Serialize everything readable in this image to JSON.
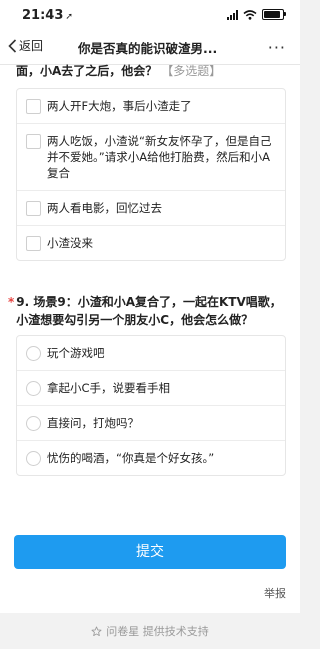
{
  "status_bar": {
    "time": "21:43",
    "location_glyph": "➚",
    "battery_level": 0.9
  },
  "nav": {
    "back_label": "返回",
    "title": "你是否真的能识破渣男...",
    "more_label": "···"
  },
  "question_prev": {
    "title": "面，小A去了之后，他会？",
    "hint": "【多选题】",
    "options": [
      "两人开F大炮，事后小渣走了",
      "两人吃饭，小渣说“新女友怀孕了，但是自己并不爱她。”请求小A给他打胎费，然后和小A复合",
      "两人看电影，回忆过去",
      "小渣没来"
    ]
  },
  "question_9": {
    "required_mark": "*",
    "title": "9. 场景9：小渣和小A复合了，一起在KTV唱歌，小渣想要勾引另一个朋友小C，他会怎么做？",
    "options": [
      "玩个游戏吧",
      "拿起小C手，说要看手相",
      "直接问，打炮吗？",
      "忧伤的喝酒，“你真是个好女孩。”"
    ]
  },
  "submit_label": "提交",
  "report_label": "举报",
  "footer_text": "问卷星 提供技术支持",
  "colors": {
    "accent": "#1e9bf0",
    "required": "#e64340"
  }
}
